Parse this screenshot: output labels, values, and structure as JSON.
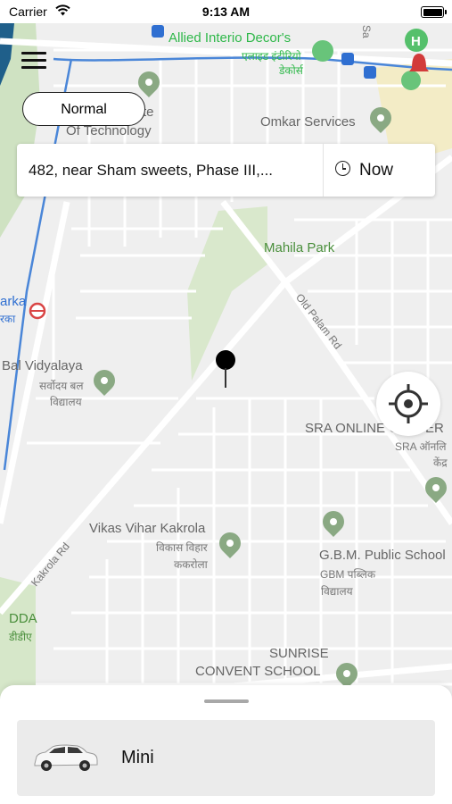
{
  "status_bar": {
    "carrier": "Carrier",
    "time": "9:13 AM"
  },
  "map": {
    "labels": {
      "allied": "Allied Interio Decor's",
      "allied_hi_1": "एलाइड इंटीरियो",
      "allied_hi_2": "डेकोर्स",
      "omkar": "Omkar Services",
      "institute_1": "te",
      "institute_2": "Of Technology",
      "mahila_park": "Mahila Park",
      "old_palam_rd": "Old Palam Rd",
      "dwarka_1": "arka",
      "dwarka_2": "रका",
      "bal_vidyalaya": "Bal Vidyalaya",
      "bal_hi_1": "सर्वोदय बल",
      "bal_hi_2": "विद्यालय",
      "sra_online": "SRA ONLINE CENTER",
      "sra_hi_1": "SRA ऑनलि",
      "sra_hi_2": "केंद्र",
      "vikas_vihar": "Vikas Vihar Kakrola",
      "vikas_hi_1": "विकास विहार",
      "vikas_hi_2": "ककरोला",
      "gbm_school": "G.B.M. Public School",
      "gbm_hi_1": "GBM पब्लिक",
      "gbm_hi_2": "विद्यालय",
      "kakrola_rd": "Kakrola Rd",
      "dda": "DDA",
      "dda_hi": "डीडीए",
      "sunrise_1": "SUNRISE",
      "sunrise_2": "CONVENT SCHOOL",
      "sa_edge": "Sa"
    }
  },
  "controls": {
    "map_type_label": "Normal",
    "pickup_address": "482, near Sham sweets, Phase III,...",
    "schedule_label": "Now"
  },
  "ride_options": [
    {
      "label": "Mini"
    }
  ],
  "colors": {
    "map_bg": "#efefef",
    "road": "#ffffff",
    "park": "#d6e7c9",
    "metro_line": "#4a86d8",
    "water": "#1f5f8a",
    "pin_green": "#8aa983"
  }
}
